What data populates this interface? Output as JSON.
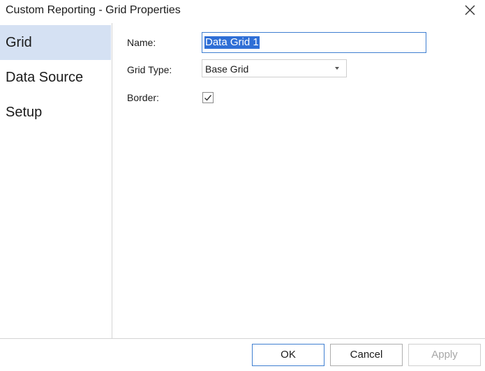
{
  "dialog": {
    "title": "Custom Reporting - Grid Properties",
    "close_icon": "close-icon"
  },
  "nav": {
    "items": [
      {
        "label": "Grid",
        "active": true
      },
      {
        "label": "Data Source",
        "active": false
      },
      {
        "label": "Setup",
        "active": false
      }
    ]
  },
  "form": {
    "name_label": "Name:",
    "name_value": "Data Grid 1",
    "grid_type_label": "Grid Type:",
    "grid_type_value": "Base Grid",
    "border_label": "Border:",
    "border_checked": true
  },
  "buttons": {
    "ok": "OK",
    "cancel": "Cancel",
    "apply": "Apply"
  },
  "colors": {
    "nav_active_bg": "#d5e1f3",
    "accent": "#3f7fd1",
    "selection": "#2f6fd6"
  }
}
